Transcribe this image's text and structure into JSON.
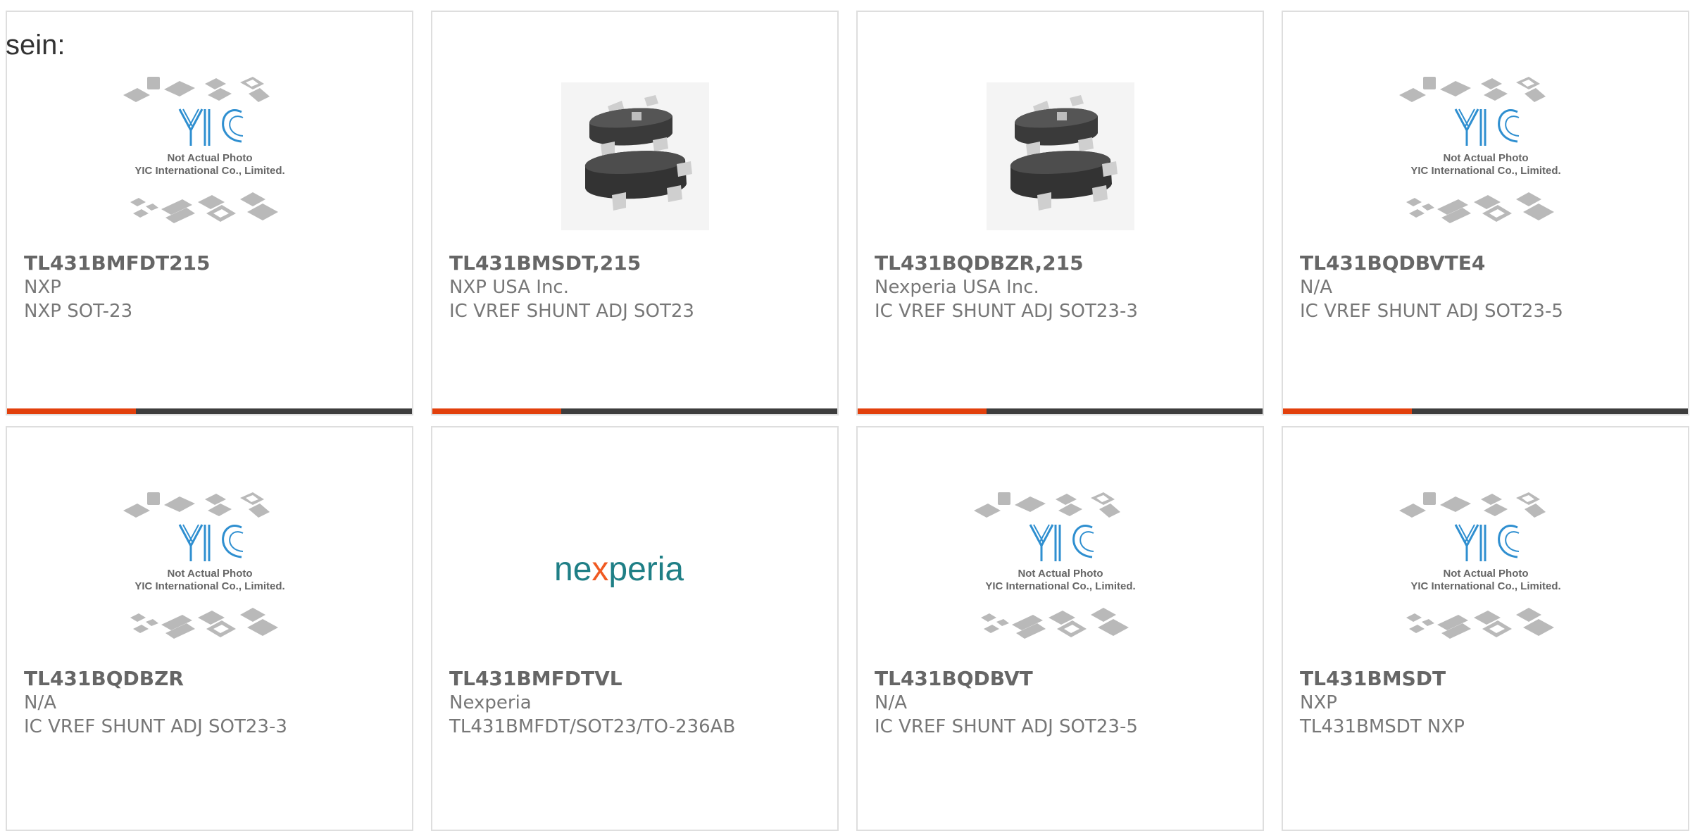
{
  "lead_text": "sein:",
  "colors": {
    "accent": "#e2400c",
    "bar": "#3d3d3d",
    "logo_blue": "#2f8fd0",
    "nexperia_teal": "#1f7f86",
    "nexperia_orange": "#f05a22"
  },
  "placeholder_caption": {
    "line1": "Not Actual Photo",
    "line2": "YIC International Co., Limited.",
    "logo": "YIC"
  },
  "nexperia_logo": {
    "text_start": "ne",
    "text_x": "x",
    "text_end": "peria"
  },
  "products": [
    {
      "part_number": "TL431BMFDT215",
      "manufacturer": "NXP",
      "description": "NXP SOT-23",
      "image": "yic-placeholder"
    },
    {
      "part_number": "TL431BMSDT,215",
      "manufacturer": "NXP USA Inc.",
      "description": "IC VREF SHUNT ADJ SOT23",
      "image": "sot23-photo"
    },
    {
      "part_number": "TL431BQDBZR,215",
      "manufacturer": "Nexperia USA Inc.",
      "description": "IC VREF SHUNT ADJ SOT23-3",
      "image": "sot23-photo"
    },
    {
      "part_number": "TL431BQDBVTE4",
      "manufacturer": "N/A",
      "description": "IC VREF SHUNT ADJ SOT23-5",
      "image": "yic-placeholder"
    },
    {
      "part_number": "TL431BQDBZR",
      "manufacturer": "N/A",
      "description": "IC VREF SHUNT ADJ SOT23-3",
      "image": "yic-placeholder"
    },
    {
      "part_number": "TL431BMFDTVL",
      "manufacturer": "Nexperia",
      "description": "TL431BMFDT/SOT23/TO-236AB",
      "image": "nexperia-logo"
    },
    {
      "part_number": "TL431BQDBVT",
      "manufacturer": "N/A",
      "description": "IC VREF SHUNT ADJ SOT23-5",
      "image": "yic-placeholder"
    },
    {
      "part_number": "TL431BMSDT",
      "manufacturer": "NXP",
      "description": "TL431BMSDT NXP",
      "image": "yic-placeholder"
    }
  ]
}
